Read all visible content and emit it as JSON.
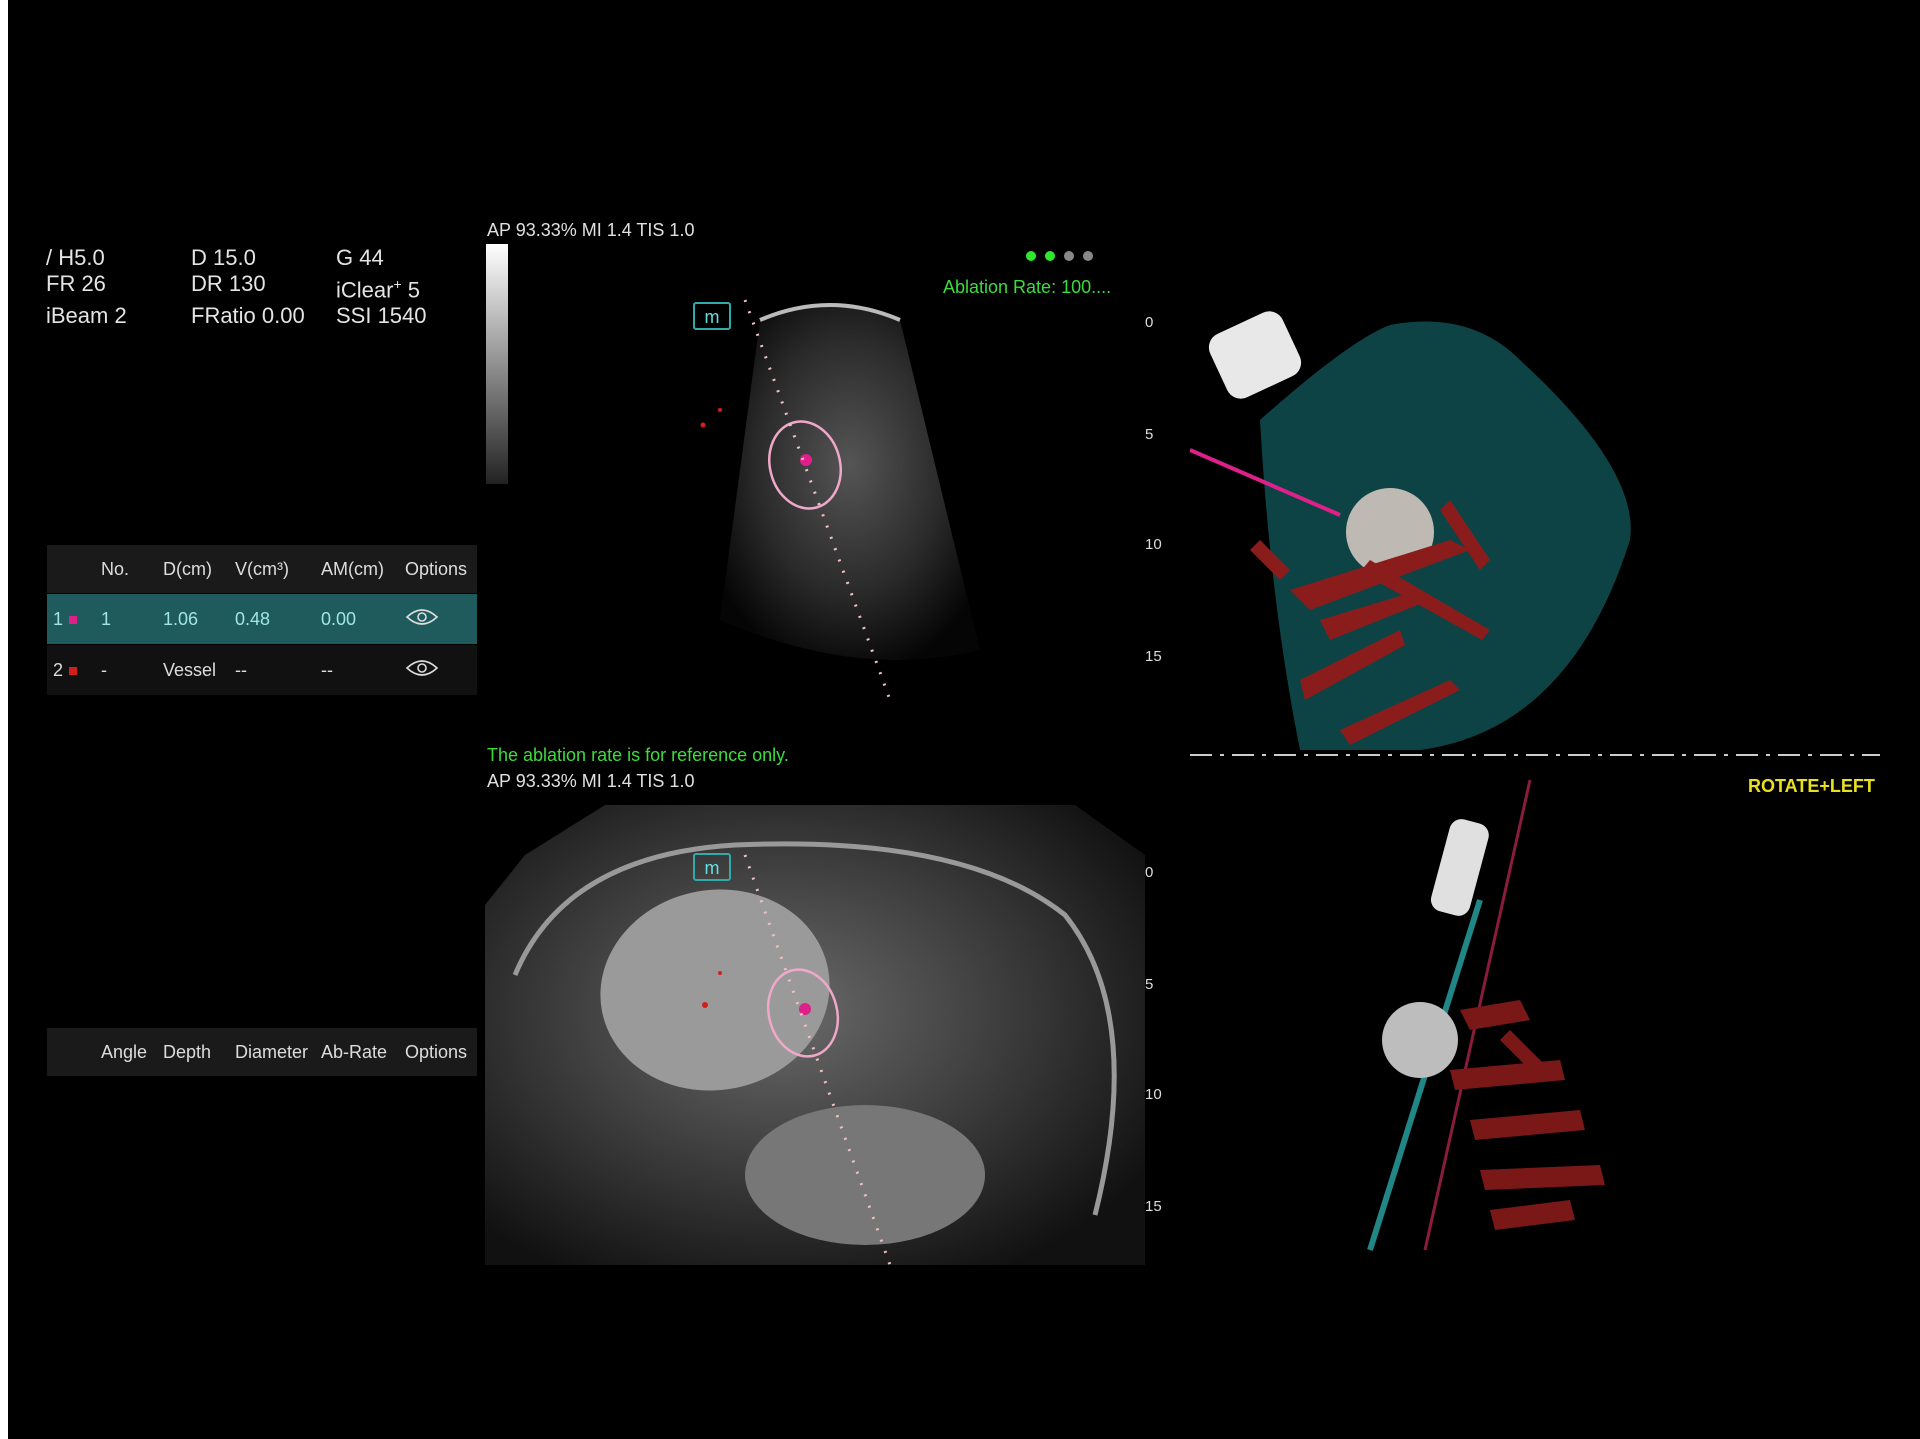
{
  "params": {
    "probe": "H5.0",
    "depth": "D 15.0",
    "gain": "G 44",
    "frame_rate": "FR 26",
    "dynamic_range": "DR 130",
    "iclear": "iClear",
    "iclear_sup": "+",
    "iclear_val": "5",
    "ibeam": "iBeam 2",
    "fratio": "FRatio 0.00",
    "ssi": "SSI 1540"
  },
  "measure_table": {
    "headers": [
      "No.",
      "D(cm)",
      "V(cm³)",
      "AM(cm)",
      "Options"
    ],
    "rows": [
      {
        "idx": "1",
        "color": "#e0208a",
        "no": "1",
        "d": "1.06",
        "v": "0.48",
        "am": "0.00",
        "options_icon": "eye-icon"
      },
      {
        "idx": "2",
        "color": "#d41e1e",
        "no": "-",
        "d": "Vessel",
        "v": "--",
        "am": "--",
        "options_icon": "eye-icon"
      }
    ]
  },
  "needle_table": {
    "headers": [
      "Angle",
      "Depth",
      "Diameter",
      "Ab-Rate",
      "Options"
    ]
  },
  "top_view": {
    "acoustic": "AP 93.33%  MI 1.4 TIS 1.0",
    "ablation_rate": "Ablation Rate: 100....",
    "status_dots": [
      "#2ee82e",
      "#2ee82e",
      "#888888",
      "#888888"
    ],
    "marker": "m",
    "depth_ticks": [
      "0",
      "5",
      "10",
      "15"
    ]
  },
  "bottom_view": {
    "reference_note": "The ablation rate is for reference only.",
    "acoustic": "AP 93.33%  MI 1.4 TIS 1.0",
    "marker": "m",
    "depth_ticks": [
      "0",
      "5",
      "10",
      "15"
    ]
  },
  "render_3d": {
    "rotate_label": "ROTATE+LEFT"
  }
}
